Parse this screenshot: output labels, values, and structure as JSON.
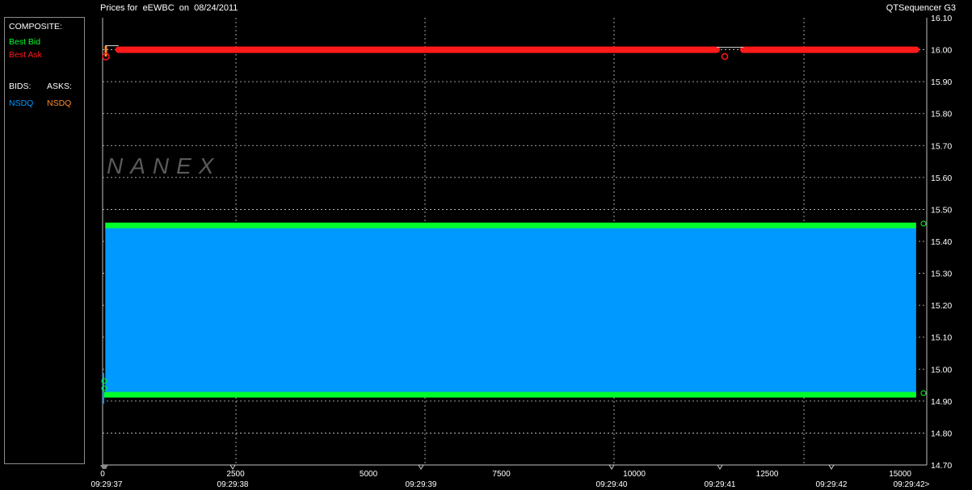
{
  "header": {
    "title": "Prices for  eEWBC  on  08/24/2011",
    "app_name": "QTSequencer G3"
  },
  "legend": {
    "composite_label": "COMPOSITE:",
    "best_bid_label": "Best Bid",
    "best_ask_label": "Best Ask",
    "bids_label": "BIDS:",
    "asks_label": "ASKS:",
    "bid_exchange": "NSDQ",
    "ask_exchange": "NSDQ"
  },
  "watermark": "NANEX",
  "colors": {
    "best_bid": "#00ff2a",
    "best_ask": "#ff1a1a",
    "nsdq_bid": "#0099ff",
    "nsdq_ask": "#ff8a2a",
    "grid": "#cfcfcf",
    "axis_text": "#ffffff"
  },
  "chart_data": {
    "type": "line",
    "x_ticks": [
      "0",
      "2500",
      "5000",
      "7500",
      "10000",
      "12500",
      "15000"
    ],
    "x_tick_values": [
      0,
      2500,
      5000,
      7500,
      10000,
      12500,
      15000
    ],
    "time_labels": [
      "09:29:37",
      "09:29:38",
      "09:29:39",
      "09:29:40",
      "09:29:41",
      "09:29:42",
      "09:29:42>"
    ],
    "y_ticks": [
      "16.10",
      "16.00",
      "15.90",
      "15.80",
      "15.70",
      "15.60",
      "15.50",
      "15.40",
      "15.30",
      "15.20",
      "15.10",
      "15.00",
      "14.90",
      "14.80",
      "14.70"
    ],
    "xlim": [
      0,
      15500
    ],
    "ylim": [
      14.7,
      16.1
    ],
    "series": [
      {
        "name": "Best Bid",
        "x": [
          0,
          50,
          15300
        ],
        "y": [
          14.92,
          15.45,
          15.45
        ]
      },
      {
        "name": "Best Bid",
        "x": [
          0,
          15300
        ],
        "y": [
          14.92,
          14.92
        ]
      },
      {
        "name": "Best Ask",
        "x": [
          0,
          300,
          11550,
          12050,
          15300
        ],
        "y": [
          16.0,
          16.0,
          16.0,
          16.0,
          16.0
        ]
      },
      {
        "name": "NSDQ",
        "x": [
          0,
          50,
          15300
        ],
        "y": [
          14.88,
          15.44,
          15.44
        ]
      },
      {
        "name": "NSDQ",
        "x": [
          0,
          15300
        ],
        "y": [
          16.0,
          16.0
        ]
      }
    ],
    "grid": true
  }
}
